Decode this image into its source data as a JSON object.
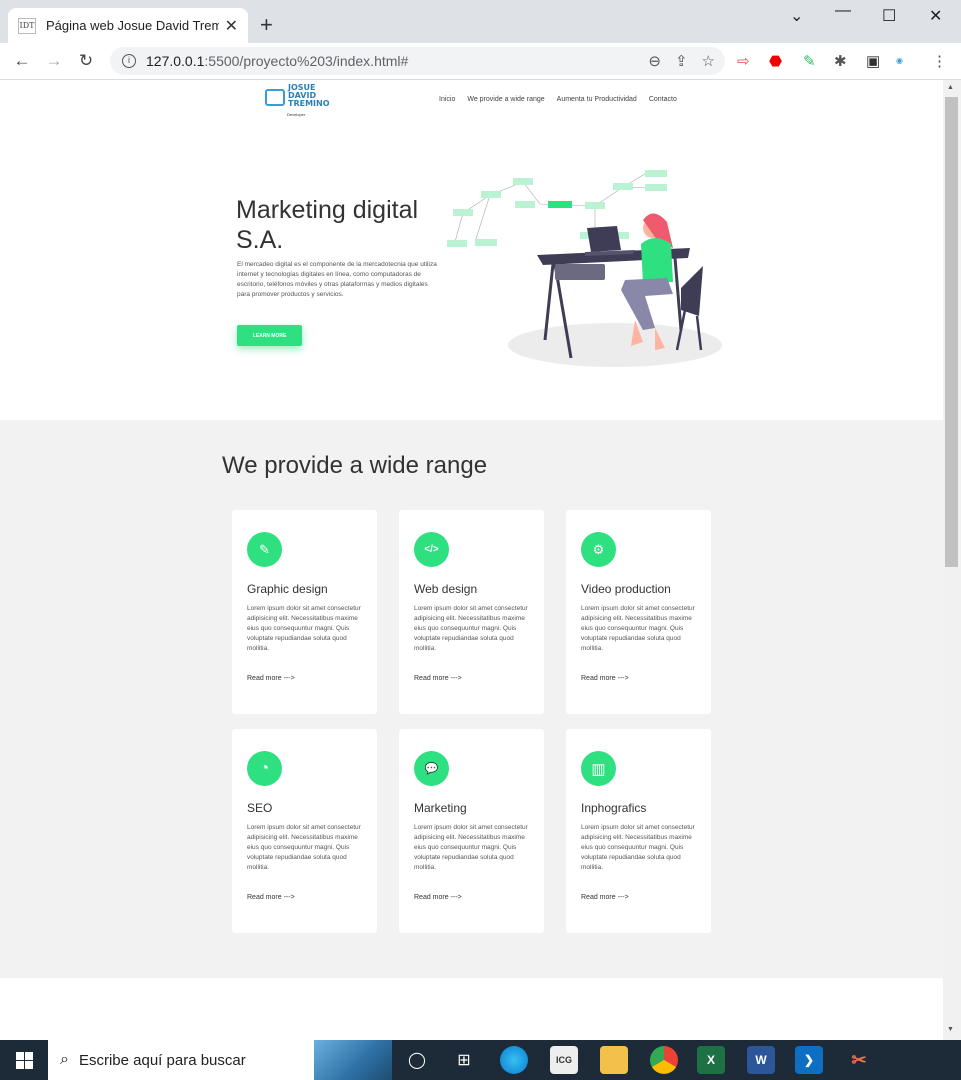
{
  "browser": {
    "tab_title": "Página web Josue David Treminio",
    "tab_favicon": "IDT",
    "url": "127.0.0.1",
    "url_rest": ":5500/proyecto%203/index.html#",
    "new_tab": "+",
    "close_tab": "✕",
    "minimize": "⌄",
    "maximize": "—",
    "restore": "☐",
    "close_window": "✕"
  },
  "site": {
    "logo_lines": [
      "JOSUE",
      "DAVID",
      "TREMINO"
    ],
    "logo_sub": "Developer",
    "nav": [
      "Inicio",
      "We provide a wide range",
      "Aumenta tu Productividad",
      "Contacto"
    ],
    "hero_title": "Marketing digital S.A.",
    "hero_text": "El mercadeo digital es el componente de la mercadotecnia que utiliza internet y tecnologías digitales en línea, como computadoras de escritorio, teléfonos móviles y otras plataformas y medios digitales para promover productos y servicios.",
    "hero_button": "LEARN MORE",
    "services_title": "We provide a wide range",
    "cards": [
      {
        "title": "Graphic design",
        "icon": "brush-icon",
        "glyph": "✎",
        "text": "Lorem ipsum dolor sit amet consectetur adipisicing elit. Necessitatibus maxime eius quo consequuntur magni. Quis voluptate repudiandae soluta quod mollitia.",
        "link": "Read more --->"
      },
      {
        "title": "Web design",
        "icon": "code-icon",
        "glyph": "</>",
        "text": "Lorem ipsum dolor sit amet consectetur adipisicing elit. Necessitatibus maxime eius quo consequuntur magni. Quis voluptate repudiandae soluta quod mollitia.",
        "link": "Read more --->"
      },
      {
        "title": "Video production",
        "icon": "gear-icon",
        "glyph": "⚙",
        "text": "Lorem ipsum dolor sit amet consectetur adipisicing elit. Necessitatibus maxime eius quo consequuntur magni. Quis voluptate repudiandae soluta quod mollitia.",
        "link": "Read more --->"
      },
      {
        "title": "SEO",
        "icon": "pie-chart-icon",
        "glyph": "◔",
        "text": "Lorem ipsum dolor sit amet consectetur adipisicing elit. Necessitatibus maxime eius quo consequuntur magni. Quis voluptate repudiandae soluta quod mollitia.",
        "link": "Read more --->"
      },
      {
        "title": "Marketing",
        "icon": "comments-icon",
        "glyph": "💬",
        "text": "Lorem ipsum dolor sit amet consectetur adipisicing elit. Necessitatibus maxime eius quo consequuntur magni. Quis voluptate repudiandae soluta quod mollitia.",
        "link": "Read more --->"
      },
      {
        "title": "Inphografics",
        "icon": "bar-chart-icon",
        "glyph": "▥",
        "text": "Lorem ipsum dolor sit amet consectetur adipisicing elit. Necessitatibus maxime eius quo consequuntur magni. Quis voluptate repudiandae soluta quod mollitia.",
        "link": "Read more --->"
      }
    ]
  },
  "taskbar": {
    "search_placeholder": "Escribe aquí para buscar"
  },
  "colors": {
    "accent": "#2ee07f",
    "text": "#333333",
    "section_bg": "#f2f2f2"
  }
}
